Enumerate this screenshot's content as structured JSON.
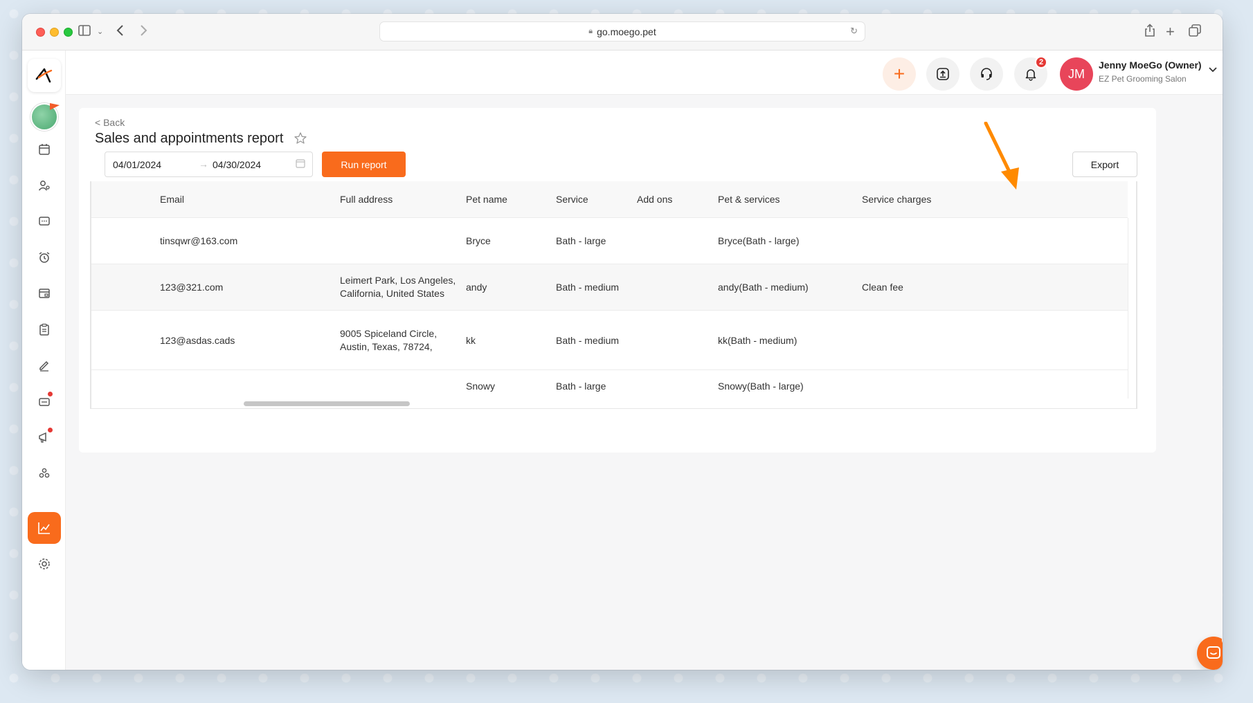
{
  "browser": {
    "url": "go.moego.pet"
  },
  "header": {
    "notifications_count": "2",
    "user_initials": "JM",
    "user_name": "Jenny MoeGo (Owner)",
    "user_org": "EZ Pet Grooming Salon"
  },
  "page": {
    "back_label": "< Back",
    "title": "Sales and appointments report",
    "date_start": "04/01/2024",
    "date_end": "04/30/2024",
    "run_label": "Run report",
    "export_label": "Export"
  },
  "table": {
    "columns": [
      "Email",
      "Full address",
      "Pet name",
      "Service",
      "Add ons",
      "Pet & services",
      "Service charges"
    ],
    "rows": [
      {
        "email": "tinsqwr@163.com",
        "address1": "",
        "address2": "",
        "pet": "Bryce",
        "service": "Bath - large",
        "addons": "",
        "pet_services": "Bryce(Bath - large)",
        "charges": ""
      },
      {
        "email": "123@321.com",
        "address1": "Leimert Park, Los Angeles,",
        "address2": "California, United States",
        "pet": "andy",
        "service": "Bath - medium",
        "addons": "",
        "pet_services": "andy(Bath - medium)",
        "charges": "Clean fee"
      },
      {
        "email": "123@asdas.cads",
        "address1": "9005 Spiceland Circle,",
        "address2": "Austin, Texas, 78724,",
        "pet": "kk",
        "service": "Bath - medium",
        "addons": "",
        "pet_services": "kk(Bath - medium)",
        "charges": ""
      },
      {
        "email": "",
        "address1": "",
        "address2": "",
        "pet": "Snowy",
        "service": "Bath - large",
        "addons": "",
        "pet_services": "Snowy(Bath - large)",
        "charges": ""
      }
    ]
  },
  "chat": {
    "badge_count": "2"
  },
  "colors": {
    "accent": "#f96b1c",
    "badge": "#e53935",
    "avatar": "#e8455a"
  }
}
